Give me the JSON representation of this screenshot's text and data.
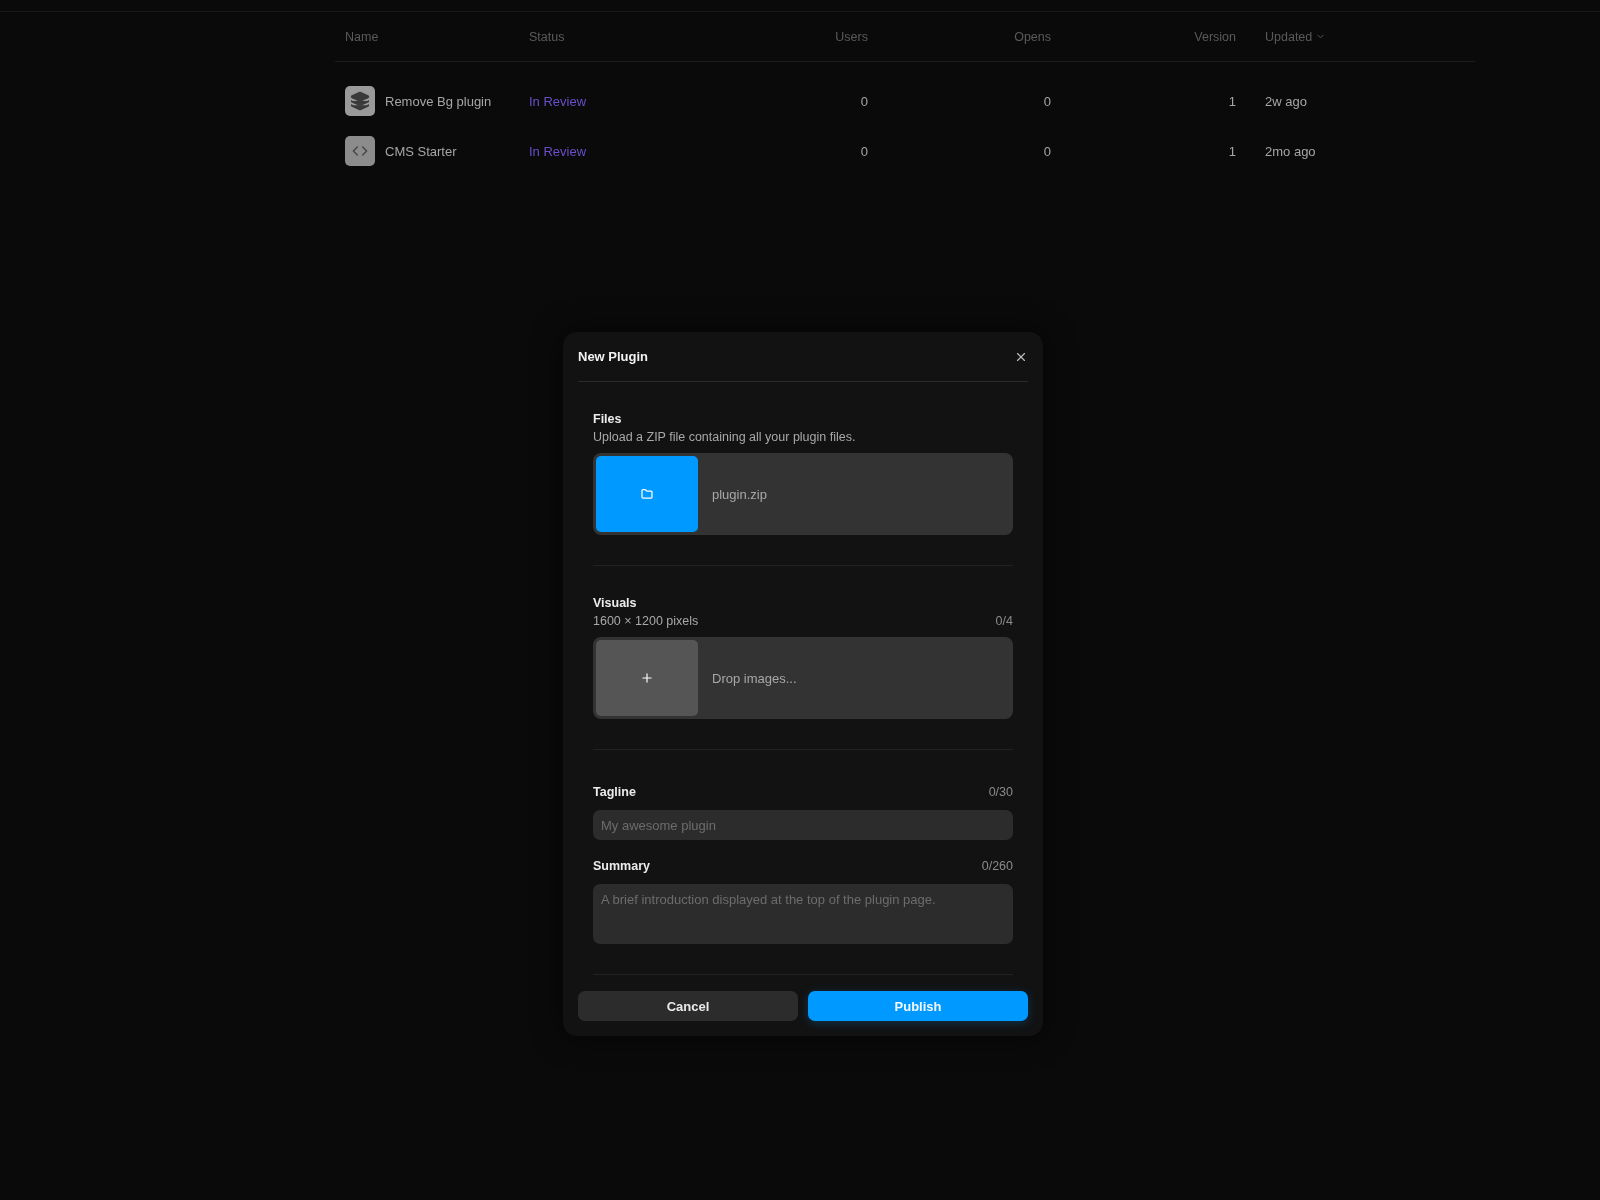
{
  "table": {
    "columns": [
      {
        "label": "Name",
        "sorted": false
      },
      {
        "label": "Status",
        "sorted": false
      },
      {
        "label": "Users",
        "sorted": false
      },
      {
        "label": "Opens",
        "sorted": false
      },
      {
        "label": "Version",
        "sorted": false
      },
      {
        "label": "Updated",
        "sorted": true
      }
    ],
    "rows": [
      {
        "kind": "layers",
        "name": "Remove Bg plugin",
        "status": "In Review",
        "users": "0",
        "opens": "0",
        "version": "1",
        "updated": "2w ago"
      },
      {
        "kind": "code",
        "name": "CMS Starter",
        "status": "In Review",
        "users": "0",
        "opens": "0",
        "version": "1",
        "updated": "2mo ago"
      }
    ]
  },
  "dialog": {
    "title": "New Plugin",
    "files": {
      "label": "Files",
      "description": "Upload a ZIP file containing all your plugin files.",
      "file_name": "plugin.zip"
    },
    "visuals": {
      "label": "Visuals",
      "hint": "1600 × 1200 pixels",
      "count": "0/4",
      "placeholder": "Drop images..."
    },
    "tagline": {
      "label": "Tagline",
      "count": "0/30",
      "placeholder": "My awesome plugin"
    },
    "summary": {
      "label": "Summary",
      "count": "0/260",
      "placeholder": "A brief introduction displayed at the top of the plugin page."
    },
    "buttons": [
      {
        "label": "Cancel",
        "kind": "secondary"
      },
      {
        "label": "Publish",
        "kind": "primary"
      }
    ]
  }
}
